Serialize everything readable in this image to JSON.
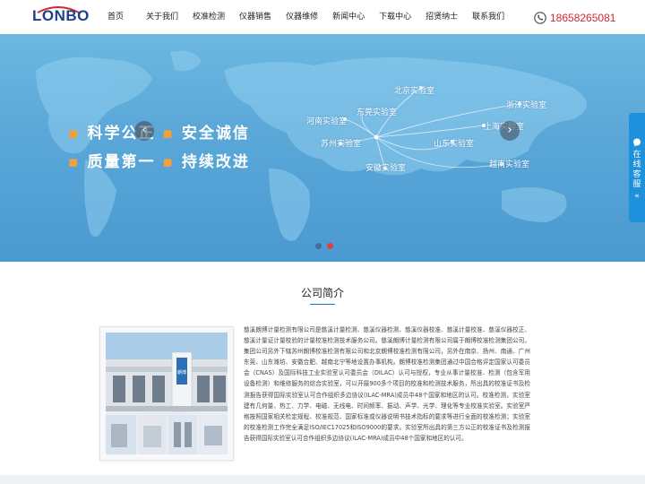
{
  "header": {
    "logo_text": "LONBO",
    "nav": [
      {
        "label": "首页"
      },
      {
        "label": "关于我们"
      },
      {
        "label": "校准检测"
      },
      {
        "label": "仪器销售"
      },
      {
        "label": "仪器维修"
      },
      {
        "label": "新闻中心"
      },
      {
        "label": "下载中心"
      },
      {
        "label": "招贤纳士"
      },
      {
        "label": "联系我们"
      }
    ],
    "phone": "18658265081",
    "phone_icon": "phone-icon"
  },
  "banner": {
    "slogan_line1_a": "科学公正",
    "slogan_line1_b": "安全诚信",
    "slogan_line2_a": "质量第一",
    "slogan_line2_b": "持续改进",
    "labs": [
      {
        "name": "北京实验室"
      },
      {
        "name": "浙江实验室"
      },
      {
        "name": "河南实验室"
      },
      {
        "name": "东莞实验室"
      },
      {
        "name": "上海实验室"
      },
      {
        "name": "苏州实验室"
      },
      {
        "name": "山东实验室"
      },
      {
        "name": "越南实验室"
      },
      {
        "name": "安徽实验室"
      }
    ],
    "prev_arrow": "‹",
    "next_arrow": "›",
    "slide_count": 2,
    "active_slide": 2,
    "colors": {
      "dot_inactive": "#3f6f9b",
      "dot_active": "#e0403a",
      "accent_dot": "#f3a03a"
    }
  },
  "float": {
    "label": "在线客服",
    "collapse": "«"
  },
  "intro": {
    "title": "公司简介",
    "text": "慈溪朗博计量检测有限公司是慈溪计量检测、慈溪仪器检测、慈溪仪器校准、慈溪计量校准、慈溪仪器校正、慈溪计量证计量校验的计量校准检测技术服务公司。慈溪朗博计量检测有限公司属于朗博校准检测集团公司，集团公司另外下辖苏州朗博校准检测有限公司和北京朗博校准检测有限公司，另外在南京、扬州、南通、广州东莞、山东潍坊、安徽合肥、越南北宁等地设置办事机构。朗博校准检测集团通过中国合格评定国家认可委员会（CNAS）及国际科技工业实验室认可委员会（DILAC）认可与授权，专业从事计量校准、检测（包含军用设备检测）和维修服务的综合实验室，可以开展900多个项目的校准和检测技术服务，所出具的校准证书及检测报告获得国际实验室认可合作组织多边协议(ILAC-MRA)成员中48个国家和地区的认可。校准检测，实验室建有几何量、热工、力学、电磁、无线电、时间频率、振动、声学、光学、理化等专业校准实验室。实验室严格按照国家相关检定规程、校准规范、国家标准或仪器说明书技术指标的要求等进行全面的校准检测；实验室的校准检测工作完全满足ISO/IEC17025和ISO9000的要求。实验室所出具的第三方公正的校准证书及检测报告获得国际实验室认可合作组织多边协议(ILAC-MRA)成员中48个国家和地区的认可。",
    "photo_sign": "朗博"
  }
}
